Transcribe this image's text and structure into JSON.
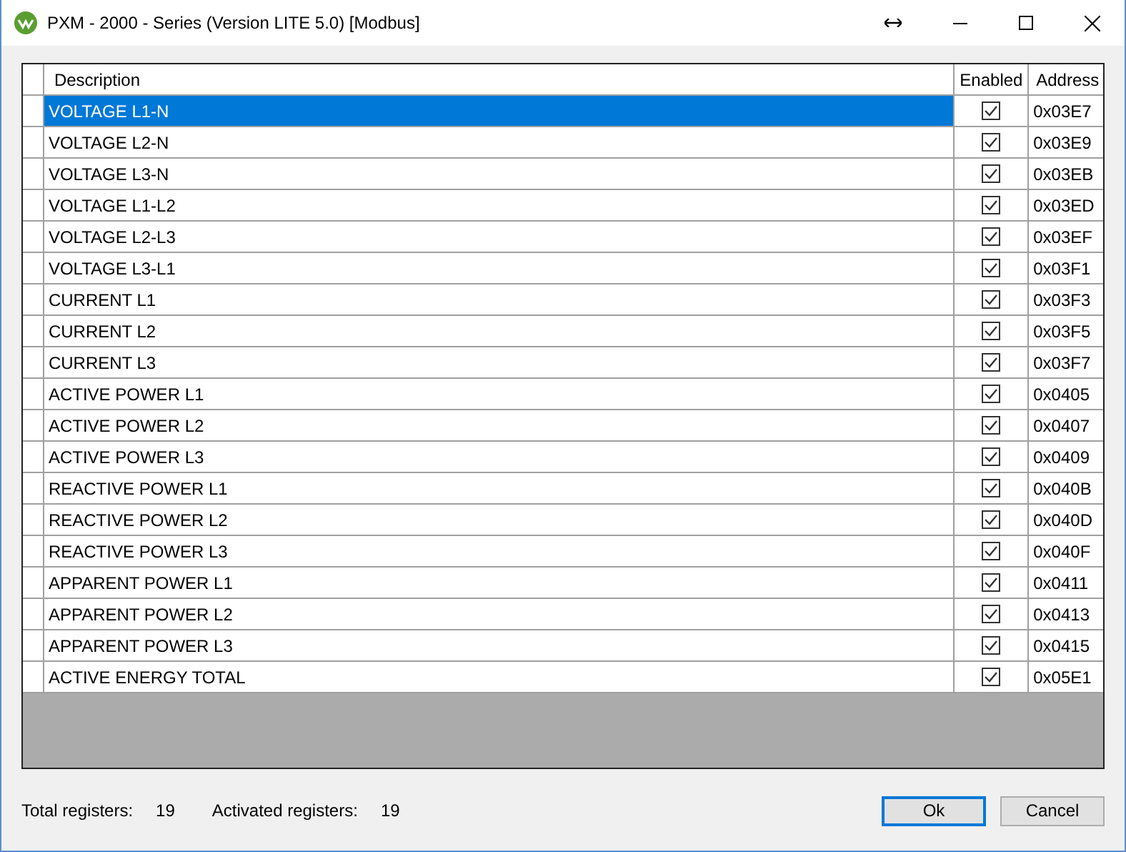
{
  "window": {
    "title": "PXM - 2000 - Series (Version LITE 5.0) [Modbus]"
  },
  "table": {
    "columns": [
      "Description",
      "Enabled",
      "Address"
    ],
    "rows": [
      {
        "description": "VOLTAGE L1-N",
        "enabled": true,
        "address": "0x03E7",
        "selected": true
      },
      {
        "description": "VOLTAGE L2-N",
        "enabled": true,
        "address": "0x03E9",
        "selected": false
      },
      {
        "description": "VOLTAGE L3-N",
        "enabled": true,
        "address": "0x03EB",
        "selected": false
      },
      {
        "description": "VOLTAGE L1-L2",
        "enabled": true,
        "address": "0x03ED",
        "selected": false
      },
      {
        "description": "VOLTAGE L2-L3",
        "enabled": true,
        "address": "0x03EF",
        "selected": false
      },
      {
        "description": "VOLTAGE L3-L1",
        "enabled": true,
        "address": "0x03F1",
        "selected": false
      },
      {
        "description": "CURRENT L1",
        "enabled": true,
        "address": "0x03F3",
        "selected": false
      },
      {
        "description": "CURRENT L2",
        "enabled": true,
        "address": "0x03F5",
        "selected": false
      },
      {
        "description": "CURRENT L3",
        "enabled": true,
        "address": "0x03F7",
        "selected": false
      },
      {
        "description": "ACTIVE POWER L1",
        "enabled": true,
        "address": "0x0405",
        "selected": false
      },
      {
        "description": "ACTIVE POWER L2",
        "enabled": true,
        "address": "0x0407",
        "selected": false
      },
      {
        "description": "ACTIVE POWER L3",
        "enabled": true,
        "address": "0x0409",
        "selected": false
      },
      {
        "description": "REACTIVE POWER L1",
        "enabled": true,
        "address": "0x040B",
        "selected": false
      },
      {
        "description": "REACTIVE POWER L2",
        "enabled": true,
        "address": "0x040D",
        "selected": false
      },
      {
        "description": "REACTIVE POWER L3",
        "enabled": true,
        "address": "0x040F",
        "selected": false
      },
      {
        "description": "APPARENT POWER L1",
        "enabled": true,
        "address": "0x0411",
        "selected": false
      },
      {
        "description": "APPARENT POWER L2",
        "enabled": true,
        "address": "0x0413",
        "selected": false
      },
      {
        "description": "APPARENT POWER L3",
        "enabled": true,
        "address": "0x0415",
        "selected": false
      },
      {
        "description": "ACTIVE ENERGY TOTAL",
        "enabled": true,
        "address": "0x05E1",
        "selected": false
      }
    ]
  },
  "status": {
    "total_label": "Total registers:",
    "total_value": "19",
    "activated_label": "Activated registers:",
    "activated_value": "19"
  },
  "buttons": [
    "Ok",
    "Cancel"
  ]
}
